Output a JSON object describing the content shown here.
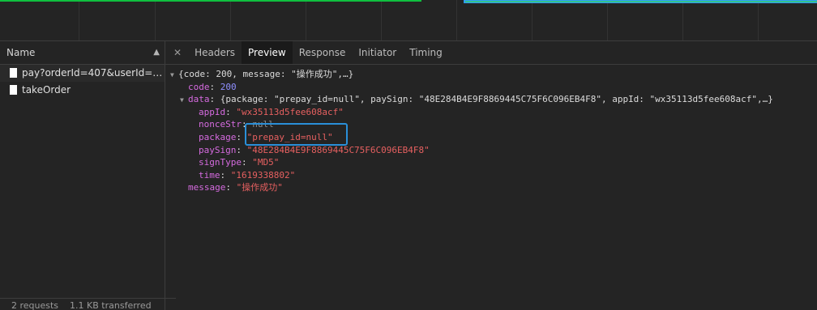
{
  "network_list": {
    "header_label": "Name",
    "rows": [
      {
        "name": "pay?orderId=407&userId=27..."
      },
      {
        "name": "takeOrder"
      }
    ],
    "status": {
      "requests": "2 requests",
      "transferred": "1.1 KB transferred"
    }
  },
  "tabs": {
    "headers": "Headers",
    "preview": "Preview",
    "response": "Response",
    "initiator": "Initiator",
    "timing": "Timing"
  },
  "preview": {
    "root_summary": "{code: 200, message: \"操作成功\",…}",
    "code_key": "code",
    "code_value": "200",
    "data_key": "data",
    "data_summary": "{package: \"prepay_id=null\", paySign: \"48E284B4E9F8869445C75F6C096EB4F8\", appId: \"wx35113d5fee608acf\",…}",
    "fields": [
      {
        "key": "appId",
        "value": "\"wx35113d5fee608acf\"",
        "type": "string"
      },
      {
        "key": "nonceStr",
        "value": "null",
        "type": "null"
      },
      {
        "key": "package",
        "value": "\"prepay_id=null\"",
        "type": "string"
      },
      {
        "key": "paySign",
        "value": "\"48E284B4E9F8869445C75F6C096EB4F8\"",
        "type": "string"
      },
      {
        "key": "signType",
        "value": "\"MD5\"",
        "type": "string"
      },
      {
        "key": "time",
        "value": "\"1619338802\"",
        "type": "string"
      }
    ],
    "message_key": "message",
    "message_value": "\"操作成功\""
  },
  "colors": {
    "highlight_box": "#2a8fd8",
    "key": "#d66be0",
    "string": "#e66060",
    "number": "#8f8fff"
  }
}
